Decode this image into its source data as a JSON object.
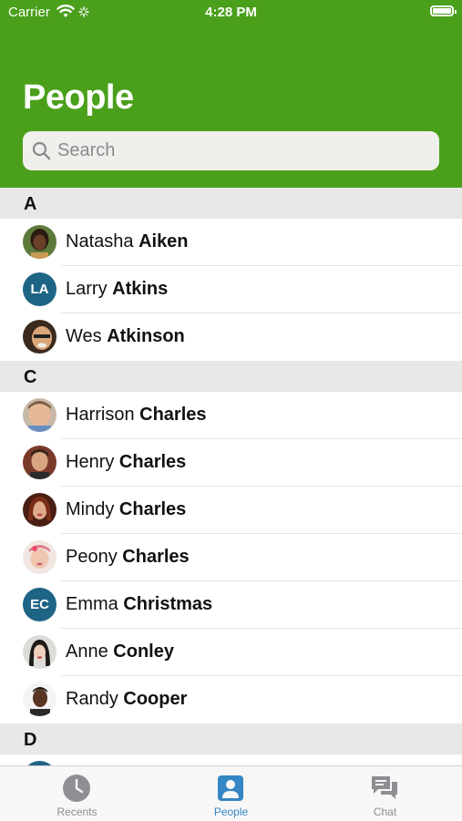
{
  "status_bar": {
    "carrier": "Carrier",
    "time": "4:28 PM"
  },
  "header": {
    "title": "People"
  },
  "search": {
    "placeholder": "Search",
    "value": ""
  },
  "colors": {
    "header_bg": "#4a9f1b",
    "initials_avatar": "#1e6485",
    "tab_active": "#3486c4"
  },
  "sections": [
    {
      "letter": "A",
      "people": [
        {
          "first": "Natasha",
          "last": "Aiken",
          "avatar": "photo"
        },
        {
          "first": "Larry",
          "last": "Atkins",
          "avatar": "initials",
          "initials": "LA"
        },
        {
          "first": "Wes",
          "last": "Atkinson",
          "avatar": "photo"
        }
      ]
    },
    {
      "letter": "C",
      "people": [
        {
          "first": "Harrison",
          "last": "Charles",
          "avatar": "photo"
        },
        {
          "first": "Henry",
          "last": "Charles",
          "avatar": "photo"
        },
        {
          "first": "Mindy",
          "last": "Charles",
          "avatar": "photo"
        },
        {
          "first": "Peony",
          "last": "Charles",
          "avatar": "photo"
        },
        {
          "first": "Emma",
          "last": "Christmas",
          "avatar": "initials",
          "initials": "EC"
        },
        {
          "first": "Anne",
          "last": "Conley",
          "avatar": "photo"
        },
        {
          "first": "Randy",
          "last": "Cooper",
          "avatar": "photo"
        }
      ]
    },
    {
      "letter": "D",
      "people": []
    }
  ],
  "tabbar": {
    "tabs": [
      {
        "label": "Recents",
        "icon": "clock-icon",
        "active": false
      },
      {
        "label": "People",
        "icon": "person-icon",
        "active": true
      },
      {
        "label": "Chat",
        "icon": "chat-bubbles-icon",
        "active": false
      }
    ]
  }
}
